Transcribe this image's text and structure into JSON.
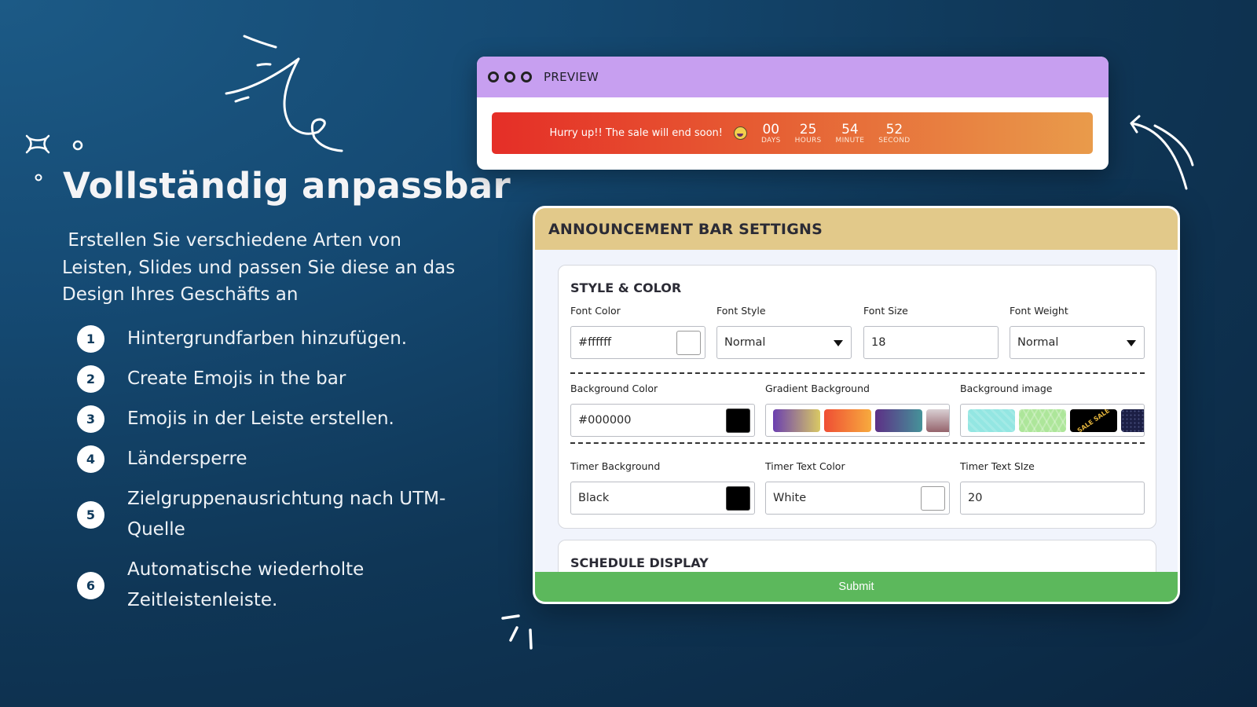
{
  "hero": {
    "title": "Vollständig anpassbar",
    "description": " Erstellen Sie verschiedene Arten von\nLeisten, Slides und passen Sie diese an das\nDesign Ihres Geschäfts an"
  },
  "features": [
    {
      "num": "1",
      "text": "Hintergrundfarben hinzufügen."
    },
    {
      "num": "2",
      "text": "Create Emojis in the bar"
    },
    {
      "num": "3",
      "text": "Emojis in der Leiste erstellen."
    },
    {
      "num": "4",
      "text": "Ländersperre"
    },
    {
      "num": "5",
      "text": "Zielgruppenausrichtung nach UTM-Quelle"
    },
    {
      "num": "6",
      "text": "Automatische wiederholte Zeitleistenleiste."
    }
  ],
  "preview": {
    "title": "PREVIEW",
    "bar": {
      "message": "Hurry up!! The sale will end soon!",
      "emoji": "laughing-emoji",
      "timer": [
        {
          "value": "00",
          "label": "DAYS"
        },
        {
          "value": "25",
          "label": "HOURS"
        },
        {
          "value": "54",
          "label": "MINUTE"
        },
        {
          "value": "52",
          "label": "SECOND"
        }
      ],
      "gradient_colors": [
        "#e52e27",
        "#e99b4b"
      ]
    }
  },
  "settings": {
    "title": "ANNOUNCEMENT BAR SETTIGNS",
    "style_section": {
      "title": "STYLE & COLOR",
      "font_color": {
        "label": "Font Color",
        "value": "#ffffff",
        "swatch": "#ffffff"
      },
      "font_style": {
        "label": "Font Style",
        "value": "Normal"
      },
      "font_size": {
        "label": "Font Size",
        "value": "18"
      },
      "font_weight": {
        "label": "Font Weight",
        "value": "Normal"
      },
      "background_color": {
        "label": "Background Color",
        "value": "#000000",
        "swatch": "#000000"
      },
      "gradient_background": {
        "label": "Gradient Background",
        "options": [
          [
            "#6b3fb0",
            "#d9c964"
          ],
          [
            "#ef4e34",
            "#f7ab3e"
          ],
          [
            "#5d2f86",
            "#459399"
          ],
          [
            "#d9cfd3",
            "#95646c"
          ]
        ]
      },
      "background_image": {
        "label": "Background image",
        "options": [
          "cyan-pattern",
          "green-pattern",
          "sale-pattern",
          "navy-pattern"
        ]
      },
      "timer_background": {
        "label": "Timer Background",
        "value": "Black",
        "swatch": "#000000"
      },
      "timer_text_color": {
        "label": "Timer Text Color",
        "value": "White",
        "swatch": "#ffffff"
      },
      "timer_text_size": {
        "label": "Timer Text SIze",
        "value": "20"
      }
    },
    "schedule_section": {
      "title": "SCHEDULE DISPLAY"
    },
    "submit_label": "Submit",
    "colors": {
      "header": "#e2c98a",
      "submit": "#5cb85c",
      "preview_header": "#c79ff0"
    }
  }
}
